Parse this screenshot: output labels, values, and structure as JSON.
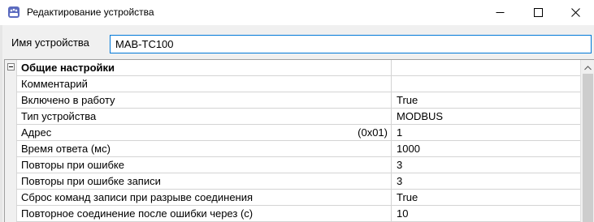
{
  "window": {
    "title": "Редактирование устройства"
  },
  "device": {
    "name_label": "Имя устройства",
    "name_value": "MAB-TC100"
  },
  "properties": {
    "section_title": "Общие настройки",
    "rows": [
      {
        "label": "Комментарий",
        "value": ""
      },
      {
        "label": "Включено в работу",
        "value": "True"
      },
      {
        "label": "Тип устройства",
        "value": "MODBUS"
      },
      {
        "label": "Адрес",
        "hint": "(0x01)",
        "value": "1"
      },
      {
        "label": "Время ответа (мс)",
        "value": "1000"
      },
      {
        "label": "Повторы при ошибке",
        "value": "3"
      },
      {
        "label": "Повторы при ошибке записи",
        "value": "3"
      },
      {
        "label": "Сброс команд записи при разрыве соединения",
        "value": "True"
      },
      {
        "label": "Повторное соединение после ошибки через (с)",
        "value": "10"
      }
    ]
  },
  "icons": {
    "app": "device-app-icon",
    "minimize": "minimize-icon",
    "maximize": "maximize-icon",
    "close": "close-icon",
    "collapse": "collapse-icon",
    "scroll_up": "scroll-up-arrow-icon"
  },
  "colors": {
    "input_focus_border": "#0078d7",
    "app_icon": "#5b6bbf"
  }
}
